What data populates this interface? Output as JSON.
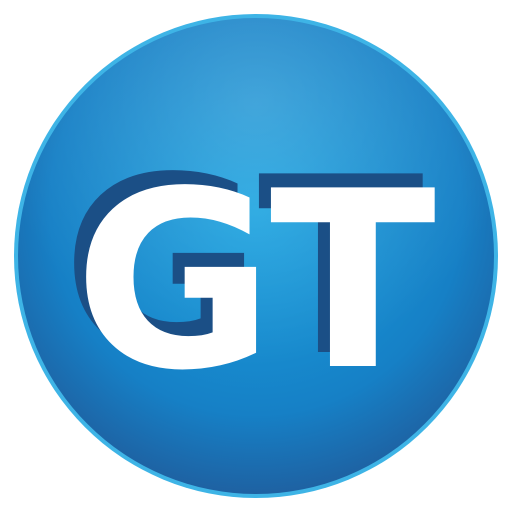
{
  "logo": {
    "text": "GT",
    "colors": {
      "circle_center": "#1AA3E0",
      "circle_edge": "#1F5E9E",
      "rim": "#3EB4E6",
      "letter_fill": "#FFFFFF",
      "letter_shadow": "#1B4F86"
    }
  }
}
